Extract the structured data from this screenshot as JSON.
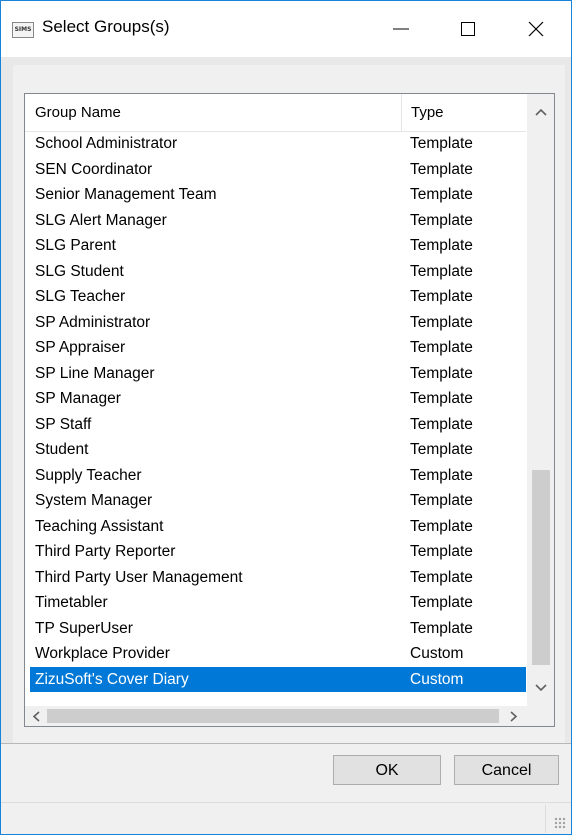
{
  "window": {
    "icon_text": "SIMS",
    "title": "Select Groups(s)"
  },
  "list": {
    "columns": {
      "name": "Group Name",
      "type": "Type"
    },
    "rows": [
      {
        "name": "School Administrator",
        "type": "Template"
      },
      {
        "name": "SEN Coordinator",
        "type": "Template"
      },
      {
        "name": "Senior Management Team",
        "type": "Template"
      },
      {
        "name": "SLG Alert Manager",
        "type": "Template"
      },
      {
        "name": "SLG Parent",
        "type": "Template"
      },
      {
        "name": "SLG Student",
        "type": "Template"
      },
      {
        "name": "SLG Teacher",
        "type": "Template"
      },
      {
        "name": "SP Administrator",
        "type": "Template"
      },
      {
        "name": "SP Appraiser",
        "type": "Template"
      },
      {
        "name": "SP Line Manager",
        "type": "Template"
      },
      {
        "name": "SP Manager",
        "type": "Template"
      },
      {
        "name": "SP Staff",
        "type": "Template"
      },
      {
        "name": "Student",
        "type": "Template"
      },
      {
        "name": "Supply Teacher",
        "type": "Template"
      },
      {
        "name": "System Manager",
        "type": "Template"
      },
      {
        "name": "Teaching Assistant",
        "type": "Template"
      },
      {
        "name": "Third Party Reporter",
        "type": "Template"
      },
      {
        "name": "Third Party User Management",
        "type": "Template"
      },
      {
        "name": "Timetabler",
        "type": "Template"
      },
      {
        "name": "TP SuperUser",
        "type": "Template"
      },
      {
        "name": "Workplace Provider",
        "type": "Custom"
      },
      {
        "name": "ZizuSoft's Cover Diary",
        "type": "Custom",
        "selected": true
      }
    ]
  },
  "buttons": {
    "ok": "OK",
    "cancel": "Cancel"
  },
  "colors": {
    "selection": "#0078d7",
    "window_border": "#1883d7"
  }
}
